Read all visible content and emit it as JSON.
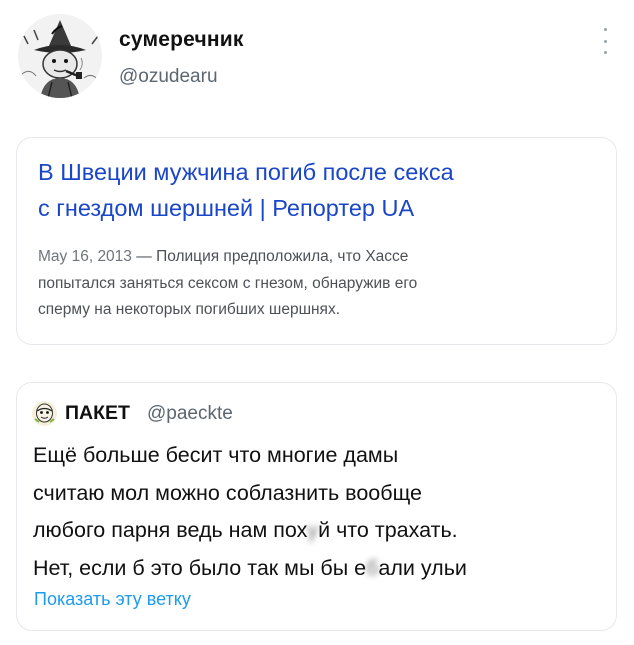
{
  "author": {
    "name": "сумеречник",
    "handle": "@ozudearu",
    "avatar_icon": "snufkin-avatar-icon"
  },
  "more_icon": "more-vertical-icon",
  "link_card": {
    "title_line1": "В Швеции мужчина погиб после секса",
    "title_line2": "с гнездом шершней | Репортер UA",
    "date": "May 16, 2013",
    "dash": " — ",
    "snippet_line1": "Полиция предположила, что Хассе",
    "snippet_line2": "попытался заняться сексом с гнезом, обнаружив его",
    "snippet_line3": "сперму на некоторых погибших шершнях.",
    "title_color": "#1a46c8"
  },
  "quoted_tweet": {
    "name": "ПАКЕТ",
    "handle": "@paeckte",
    "avatar_icon": "hacker-mask-avatar-icon",
    "line1": "Ещё больше бесит что многие дамы",
    "line2": "считаю мол можно соблазнить вообще",
    "line3_a": "любого парня ведь нам пох",
    "line3_censored": "у",
    "line3_b": "й что трахать.",
    "line4_a": "Нет, если б это было так мы бы е",
    "line4_censored": "б",
    "line4_b": "али ульи",
    "show_thread": "Показать эту ветку",
    "link_color": "#1d9bf0"
  }
}
